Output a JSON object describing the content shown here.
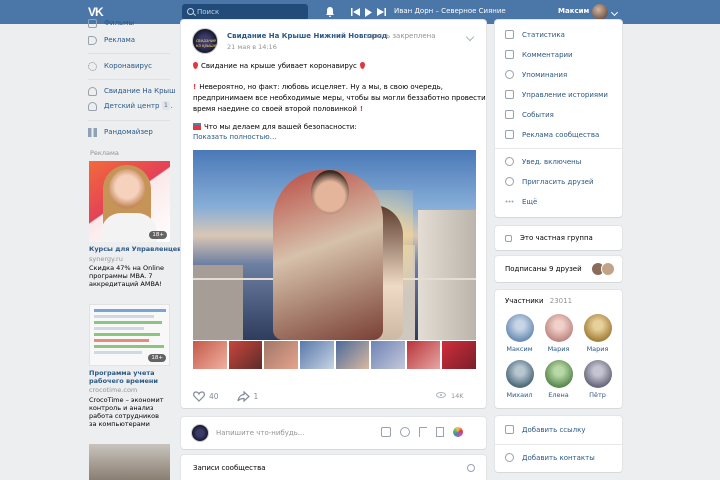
{
  "header": {
    "logo": "VK",
    "search_placeholder": "Поиск",
    "track": "Иван Дорн – Северное Сияние",
    "profile_name": "Максим"
  },
  "left_menu": {
    "items": [
      {
        "label": "Фильмы",
        "icon": "video-icon"
      },
      {
        "label": "Реклама",
        "icon": "megaphone-icon"
      },
      {
        "label": "Коронавирус",
        "icon": "virus-icon"
      },
      {
        "label": "Свидание На Крыш",
        "icon": "group-icon"
      },
      {
        "label": "Детский центр н...",
        "icon": "group-icon",
        "count": "1"
      },
      {
        "label": "Рандомайзер",
        "icon": "apps-icon"
      }
    ],
    "ads_label": "Реклама",
    "ads": [
      {
        "badge": "18+",
        "title": "Курсы для Управленцев",
        "host": "synergy.ru",
        "text": [
          "Скидка 47% на Online",
          "программы MBA. 7",
          "аккредитаций AMBA!"
        ]
      },
      {
        "badge": "18+",
        "title": "Программа учета рабочего времени",
        "title_lines": [
          "Программа учета",
          "рабочего времени"
        ],
        "host": "crocotime.com",
        "text": [
          "CrocoTime – экономит",
          "контроль и анализ",
          "работа сотрудников",
          "за компьютерами"
        ]
      }
    ]
  },
  "post": {
    "author": "Свидание На Крыше Нижний Новгород",
    "pinned": "запись закреплена",
    "date": "21 мая в 14:16",
    "avatar_text": "свидание на крыше",
    "lines": [
      "Свидание на крыше убивает коронавирус",
      "Невероятно, но факт: любовь исцеляет. Ну а мы, в свою очередь,",
      "предпринимаем все необходимые меры, чтобы вы могли беззаботно провести",
      "время наедине со своей второй половинкой",
      "Что мы делаем для вашей безопасности:"
    ],
    "show_more": "Показать полностью…",
    "likes": "40",
    "shares": "1",
    "views": "14K"
  },
  "composer": {
    "placeholder": "Напишите что-нибудь..."
  },
  "wall": {
    "tab": "Записи сообщества"
  },
  "right_menu": {
    "items": [
      {
        "label": "Статистика",
        "icon": "stats-icon"
      },
      {
        "label": "Комментарии",
        "icon": "comment-icon"
      },
      {
        "label": "Упоминания",
        "icon": "at-icon"
      },
      {
        "label": "Управление историями",
        "icon": "stories-icon"
      },
      {
        "label": "События",
        "icon": "event-icon"
      },
      {
        "label": "Реклама сообщества",
        "icon": "megaphone-icon"
      }
    ],
    "items2": [
      {
        "label": "Увед. включены",
        "icon": "bell-icon"
      },
      {
        "label": "Пригласить друзей",
        "icon": "add-user-icon"
      },
      {
        "label": "Ещё",
        "icon": "more-icon"
      }
    ],
    "private": "Это частная группа",
    "friends": "Подписаны 9 друзей",
    "members_label": "Участники",
    "members_count": "23011",
    "members": [
      {
        "name": "Максим",
        "color": "#6d8fb6"
      },
      {
        "name": "Мария",
        "color": "#c08a86"
      },
      {
        "name": "Мария",
        "color": "#a6813e"
      },
      {
        "name": "Михаил",
        "color": "#4f6b7c"
      },
      {
        "name": "Елена",
        "color": "#5b8a50"
      },
      {
        "name": "Пётр",
        "color": "#6a6a7e"
      }
    ],
    "add_link": "Добавить ссылку",
    "add_contacts": "Добавить контакты"
  },
  "colors": {
    "header": "#4a76a8",
    "link": "#2a5885",
    "background": "#edeef0"
  }
}
